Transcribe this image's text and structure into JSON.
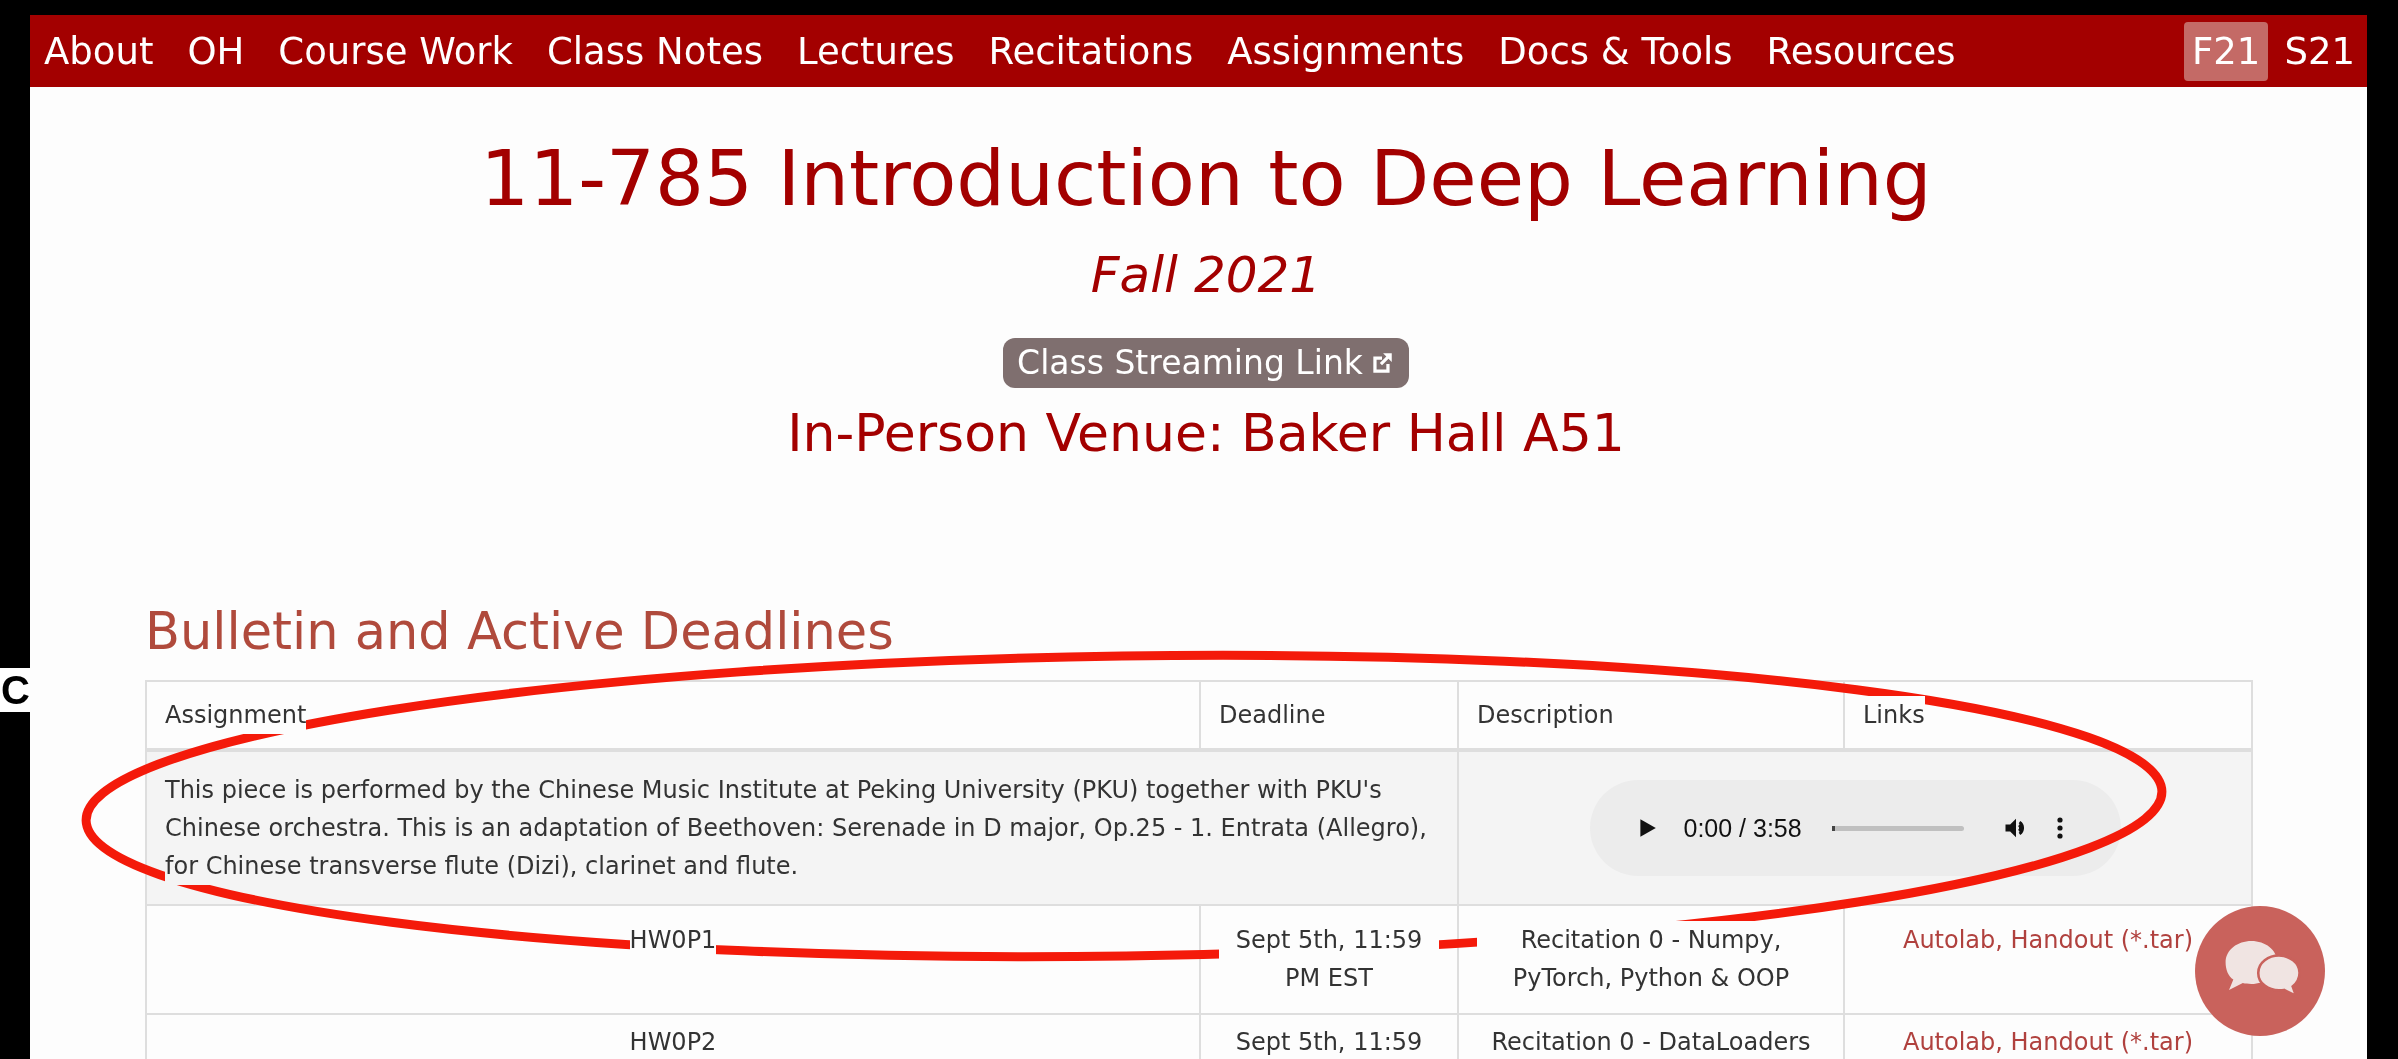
{
  "edge_text": "C",
  "nav": {
    "items": [
      "About",
      "OH",
      "Course Work",
      "Class Notes",
      "Lectures",
      "Recitations",
      "Assignments",
      "Docs & Tools",
      "Resources"
    ],
    "semesters": [
      {
        "label": "F21",
        "selected": true
      },
      {
        "label": "S21",
        "selected": false
      }
    ]
  },
  "header": {
    "title": "11-785 Introduction to Deep Learning",
    "term": "Fall 2021",
    "stream_button": "Class Streaming Link",
    "venue": "In-Person Venue: Baker Hall A51"
  },
  "bulletin": {
    "heading": "Bulletin and Active Deadlines",
    "table": {
      "columns": [
        "Assignment",
        "Deadline",
        "Description",
        "Links"
      ],
      "rows": [
        {
          "kind": "audio",
          "text": "This piece is performed by the Chinese Music Institute at Peking University (PKU) together with PKU's Chinese orchestra. This is an adaptation of Beethoven: Serenade in D major, Op.25 - 1. Entrata (Allegro), for Chinese transverse flute (Dizi), clarinet and flute.",
          "player": {
            "time": "0:00 / 3:58",
            "level": 0
          }
        },
        {
          "kind": "deadline",
          "assignment": "HW0P1",
          "deadline": "Sept 5th, 11:59 PM EST",
          "description": "Recitation 0 - Numpy, PyTorch, Python & OOP",
          "links": "Autolab, Handout (*.tar)"
        },
        {
          "kind": "deadline",
          "assignment": "HW0P2",
          "deadline": "Sept 5th, 11:59",
          "description": "Recitation 0 - DataLoaders",
          "links": "Autolab, Handout (*.tar)"
        }
      ]
    }
  }
}
